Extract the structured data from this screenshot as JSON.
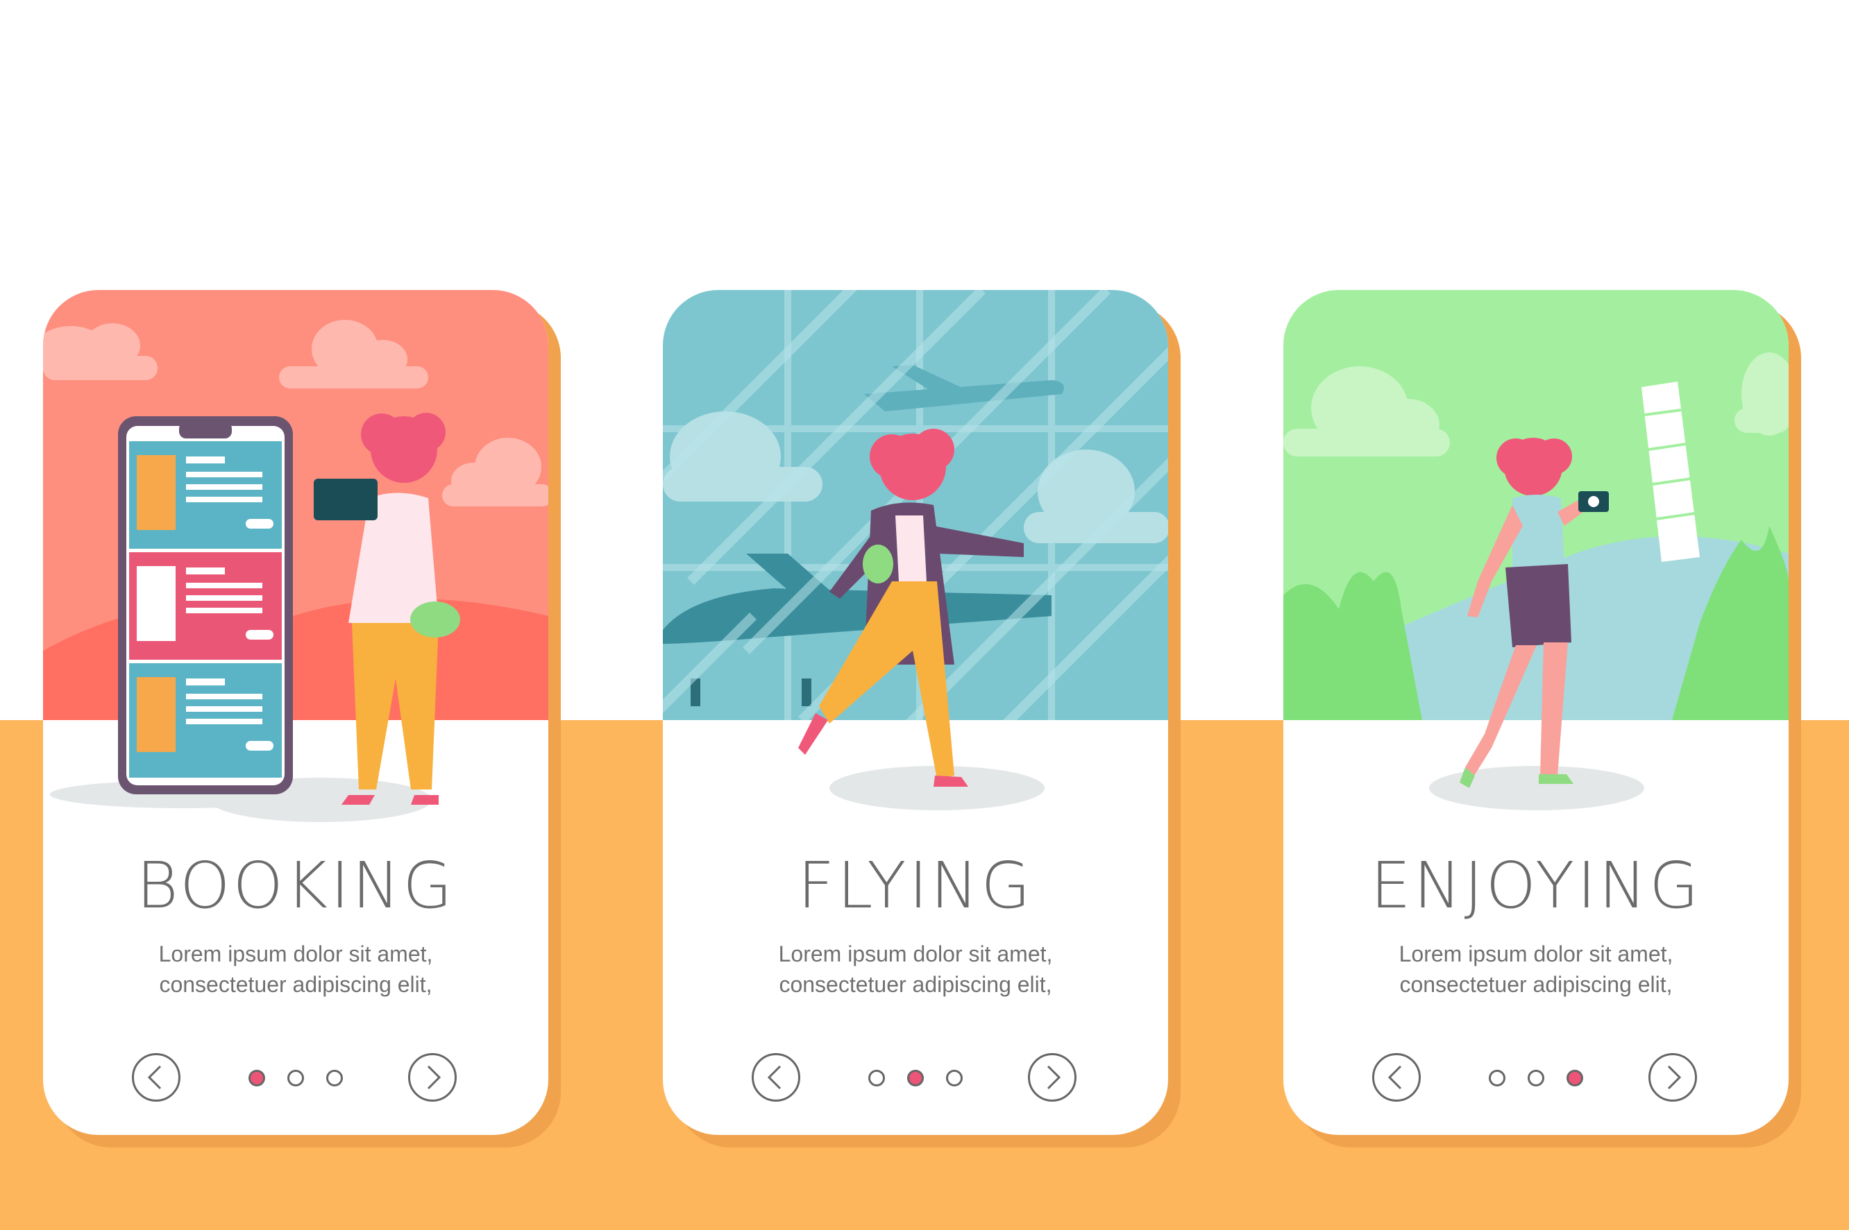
{
  "cards": [
    {
      "title": "BOOKING",
      "text_line1": "Lorem ipsum dolor sit amet,",
      "text_line2": "consectetuer adipiscing elit,",
      "active_dot": 0,
      "scene_color": "#fe8f7f"
    },
    {
      "title": "FLYING",
      "text_line1": "Lorem ipsum dolor sit amet,",
      "text_line2": "consectetuer adipiscing elit,",
      "active_dot": 1,
      "scene_color": "#7ec6cf"
    },
    {
      "title": "ENJOYING",
      "text_line1": "Lorem ipsum dolor sit amet,",
      "text_line2": "consectetuer adipiscing elit,",
      "active_dot": 2,
      "scene_color": "#a3ef9f"
    }
  ],
  "colors": {
    "page_background": "#ffffff",
    "bottom_band": "#fdb65c",
    "active_dot": "#ec5577",
    "hair": "#f0587a"
  },
  "icons": {
    "prev": "chevron-left-icon",
    "next": "chevron-right-icon"
  }
}
